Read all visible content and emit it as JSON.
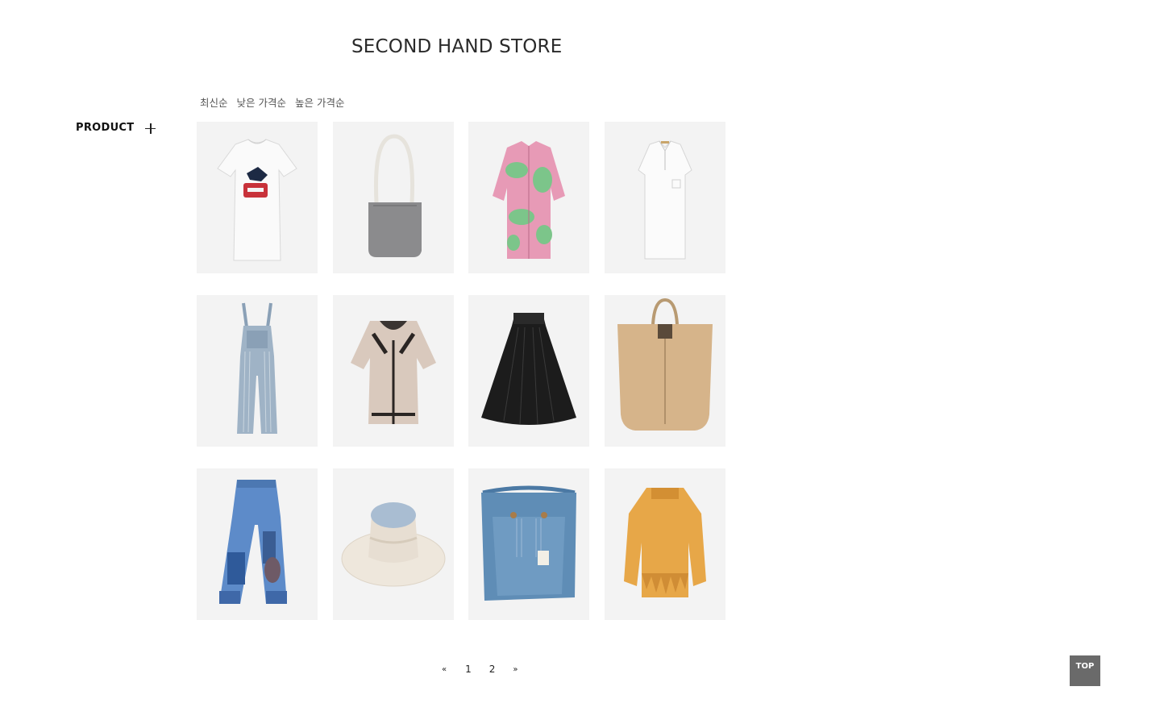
{
  "header": {
    "title": "SECOND HAND STORE"
  },
  "sort": {
    "options": [
      "최신순",
      "낮은 가격순",
      "높은 가격순"
    ]
  },
  "sidebar": {
    "label": "PRODUCT",
    "toggle_icon": "plus-icon"
  },
  "products": [
    {
      "name": "white-graphic-tshirt",
      "icon": "tshirt-icon"
    },
    {
      "name": "grey-shoulder-bag",
      "icon": "bag-icon"
    },
    {
      "name": "pink-green-print-shirt",
      "icon": "shirt-icon"
    },
    {
      "name": "white-polo-dress",
      "icon": "dress-icon"
    },
    {
      "name": "striped-overalls",
      "icon": "overalls-icon"
    },
    {
      "name": "tweed-blouse",
      "icon": "blouse-icon"
    },
    {
      "name": "black-tiered-skirt",
      "icon": "skirt-icon"
    },
    {
      "name": "beige-tote-bag",
      "icon": "tote-icon"
    },
    {
      "name": "patchwork-jeans",
      "icon": "jeans-icon"
    },
    {
      "name": "cream-bucket-hat",
      "icon": "hat-icon"
    },
    {
      "name": "denim-cross-bag",
      "icon": "denim-bag-icon"
    },
    {
      "name": "mustard-lace-blouse",
      "icon": "blouse-icon"
    }
  ],
  "pagination": {
    "prev": "«",
    "pages": [
      "1",
      "2"
    ],
    "next": "»",
    "current": "1"
  },
  "top_button": {
    "label": "TOP"
  }
}
